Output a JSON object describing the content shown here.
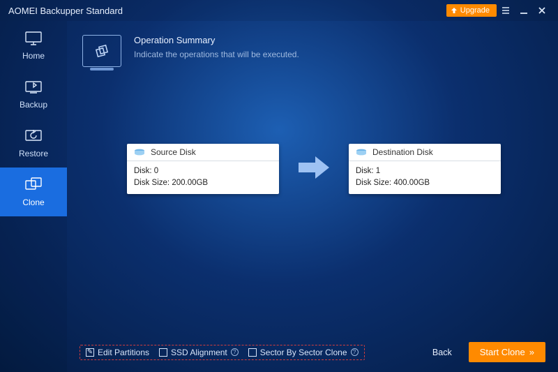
{
  "titlebar": {
    "title": "AOMEI Backupper Standard",
    "upgrade": "Upgrade"
  },
  "sidebar": {
    "items": [
      {
        "label": "Home"
      },
      {
        "label": "Backup"
      },
      {
        "label": "Restore"
      },
      {
        "label": "Clone"
      }
    ]
  },
  "summary": {
    "title": "Operation Summary",
    "subtitle": "Indicate the operations that will be executed."
  },
  "source": {
    "title": "Source Disk",
    "line1": "Disk: 0",
    "line2": "Disk Size: 200.00GB"
  },
  "destination": {
    "title": "Destination Disk",
    "line1": "Disk: 1",
    "line2": "Disk Size: 400.00GB"
  },
  "options": {
    "edit_partitions": "Edit Partitions",
    "ssd_alignment": "SSD Alignment",
    "sector_by_sector": "Sector By Sector Clone"
  },
  "footer": {
    "back": "Back",
    "start": "Start Clone"
  },
  "colors": {
    "accent": "#ff8a00",
    "active": "#1a6de0"
  }
}
